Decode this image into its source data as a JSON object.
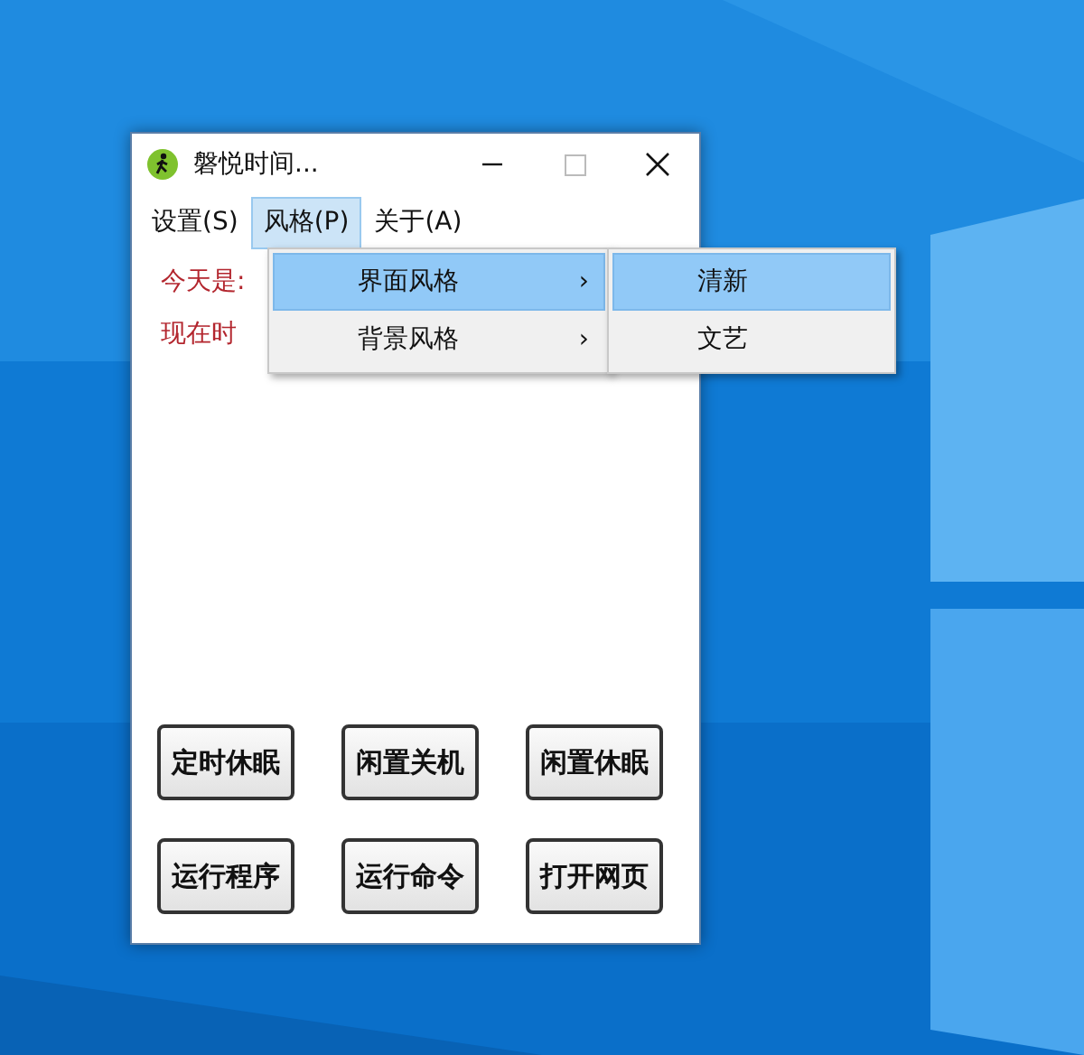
{
  "window": {
    "title": "磐悦时间..."
  },
  "menu_bar": [
    {
      "label": "设置(S)",
      "selected": false
    },
    {
      "label": "风格(P)",
      "selected": true
    },
    {
      "label": "关于(A)",
      "selected": false
    }
  ],
  "labels": [
    "今天是:",
    "现在时"
  ],
  "menu": {
    "items": [
      {
        "label": "界面风格",
        "arrow": "›",
        "selected": true
      },
      {
        "label": "背景风格",
        "arrow": "›",
        "selected": false
      }
    ]
  },
  "submenu": {
    "items": [
      {
        "label": "清新",
        "selected": true
      },
      {
        "label": "文艺",
        "selected": false
      }
    ]
  },
  "buttons": [
    "定时休眠",
    "闲置关机",
    "闲置休眠",
    "运行程序",
    "运行命令",
    "打开网页"
  ]
}
